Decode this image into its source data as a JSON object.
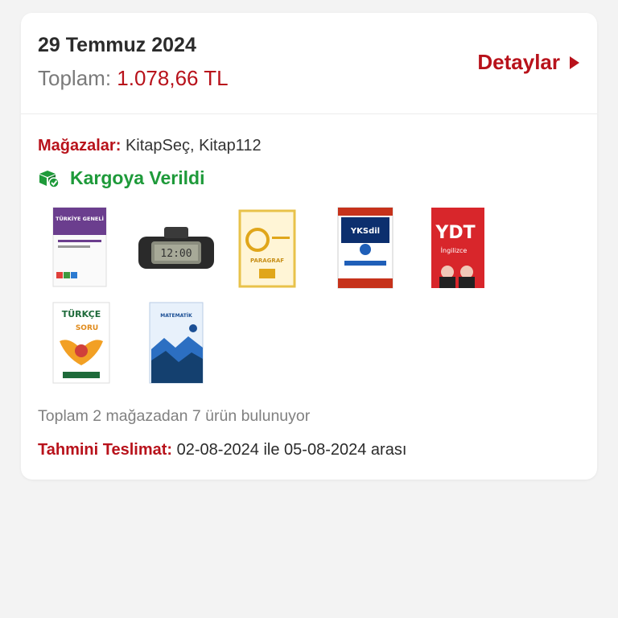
{
  "order": {
    "date": "29 Temmuz 2024",
    "total_label": "Toplam:",
    "total_value": "1.078,66 TL",
    "details_label": "Detaylar"
  },
  "stores": {
    "label": "Mağazalar:",
    "value": "KitapSeç, Kitap112"
  },
  "status": {
    "icon": "package-check-icon",
    "label": "Kargoya Verildi"
  },
  "products": [
    {
      "name": "Türkiye Geneli deneme kitabı",
      "cover_text": "TÜRKİYE GENELİ",
      "icon": "book-cover-icon"
    },
    {
      "name": "Dijital araç saati",
      "cover_text": "",
      "icon": "digital-clock-icon"
    },
    {
      "name": "Paragraf kitabı",
      "cover_text": "PARAGRAF",
      "icon": "book-cover-icon"
    },
    {
      "name": "YKSdil kitabı",
      "cover_text": "YKSdil",
      "icon": "book-cover-icon"
    },
    {
      "name": "YDT İngilizce kitabı",
      "cover_text": "YDT",
      "cover_text_2": "İngilizce",
      "icon": "book-cover-icon"
    },
    {
      "name": "TYT Türkçe soru bankası",
      "cover_text": "TÜRKÇE",
      "cover_text_2": "SORU",
      "icon": "book-cover-icon"
    },
    {
      "name": "Matematik kitabı",
      "cover_text": "MATEMATİK",
      "icon": "book-cover-icon"
    }
  ],
  "summary": "Toplam 2 mağazadan 7 ürün bulunuyor",
  "delivery": {
    "label": "Tahmini Teslimat:",
    "value": "02-08-2024 ile 05-08-2024 arası"
  },
  "colors": {
    "accent": "#b8121b",
    "success": "#1e9a3a",
    "background": "#f3f3f3"
  }
}
